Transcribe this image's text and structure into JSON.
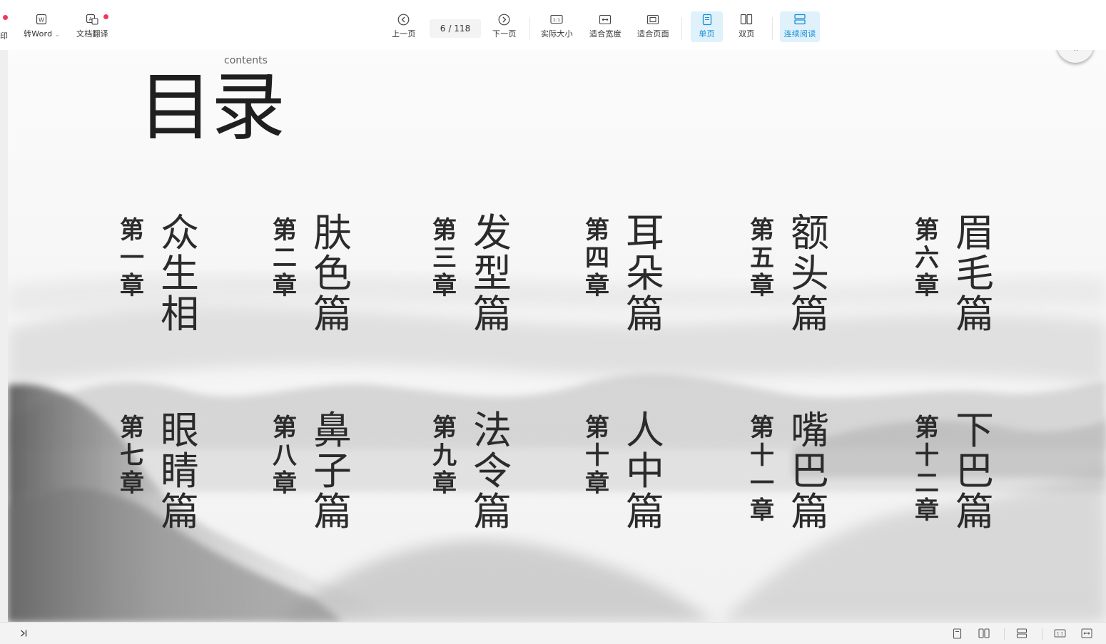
{
  "toolbar": {
    "edge_left_text": "印",
    "edge_right_text": "",
    "to_word": "转Word",
    "translate": "文档翻译",
    "prev": "上一页",
    "page_current": "6",
    "page_total": "/ 118",
    "next": "下一页",
    "actual_size": "实际大小",
    "fit_width": "适合宽度",
    "fit_page": "适合页面",
    "single_page": "单页",
    "double_page": "双页",
    "continuous": "连续阅读",
    "accent_color": "#1a8fd6",
    "notify_color": "#f0385a"
  },
  "page": {
    "subtitle": "contents",
    "title": "目录",
    "entries": [
      {
        "chapter": [
          "第",
          "一",
          "章"
        ],
        "name": [
          "众",
          "生",
          "相"
        ]
      },
      {
        "chapter": [
          "第",
          "二",
          "章"
        ],
        "name": [
          "肤",
          "色",
          "篇"
        ]
      },
      {
        "chapter": [
          "第",
          "三",
          "章"
        ],
        "name": [
          "发",
          "型",
          "篇"
        ]
      },
      {
        "chapter": [
          "第",
          "四",
          "章"
        ],
        "name": [
          "耳",
          "朵",
          "篇"
        ]
      },
      {
        "chapter": [
          "第",
          "五",
          "章"
        ],
        "name": [
          "额",
          "头",
          "篇"
        ]
      },
      {
        "chapter": [
          "第",
          "六",
          "章"
        ],
        "name": [
          "眉",
          "毛",
          "篇"
        ]
      },
      {
        "chapter": [
          "第",
          "七",
          "章"
        ],
        "name": [
          "眼",
          "睛",
          "篇"
        ]
      },
      {
        "chapter": [
          "第",
          "八",
          "章"
        ],
        "name": [
          "鼻",
          "子",
          "篇"
        ]
      },
      {
        "chapter": [
          "第",
          "九",
          "章"
        ],
        "name": [
          "法",
          "令",
          "篇"
        ]
      },
      {
        "chapter": [
          "第",
          "十",
          "章"
        ],
        "name": [
          "人",
          "中",
          "篇"
        ]
      },
      {
        "chapter": [
          "第",
          "十",
          "一",
          "章"
        ],
        "name": [
          "嘴",
          "巴",
          "篇"
        ]
      },
      {
        "chapter": [
          "第",
          "十",
          "二",
          "章"
        ],
        "name": [
          "下",
          "巴",
          "篇"
        ]
      }
    ],
    "back_icon": "double-chevron-left-icon"
  },
  "statusbar": {
    "icons": [
      "collapse-panel-icon",
      "single-page-icon",
      "double-page-icon",
      "continuous-icon",
      "actual-size-icon",
      "fit-width-icon"
    ]
  }
}
